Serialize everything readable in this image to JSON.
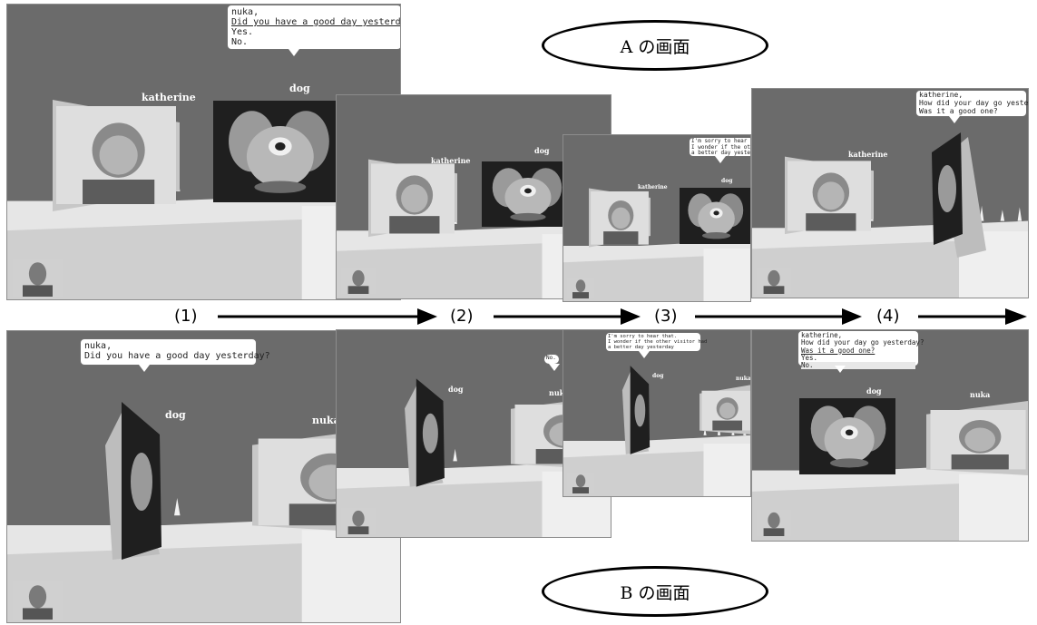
{
  "labels": {
    "screen_a": "A の画面",
    "screen_b": "B の画面"
  },
  "steps": [
    "(1)",
    "(2)",
    "(3)",
    "(4)"
  ],
  "frames": {
    "a1": {
      "name_left": "katherine",
      "name_right": "dog",
      "bubble": [
        "nuka,",
        "Did you have a good day yesterday?",
        "Yes.",
        "No."
      ]
    },
    "a2": {
      "name_left": "katherine",
      "name_right": "dog"
    },
    "a3": {
      "name_left": "katherine",
      "name_right": "dog",
      "bubble": [
        "I'm sorry to hear that.",
        "I wonder if the other",
        "a better day yesterday"
      ]
    },
    "a4": {
      "name_left": "katherine",
      "bubble": [
        "katherine,",
        "How did your day go yesterday?",
        "Was it a good one?"
      ]
    },
    "b1": {
      "name_left": "dog",
      "name_right": "nuka",
      "bubble": [
        "nuka,",
        "Did you have a good day yesterday?"
      ]
    },
    "b2": {
      "name_left": "dog",
      "name_right": "nuka",
      "bubble": [
        "No."
      ]
    },
    "b3": {
      "name_left": "dog",
      "name_right": "nuka",
      "bubble": [
        "I'm sorry to hear that.",
        "I wonder if the other visitor had",
        "a better day yesterday"
      ]
    },
    "b4": {
      "name_left": "dog",
      "name_right": "nuka",
      "bubble": [
        "katherine,",
        "How did your day go yesterday?",
        "Was it a good one?",
        "Yes.",
        "No."
      ]
    }
  }
}
